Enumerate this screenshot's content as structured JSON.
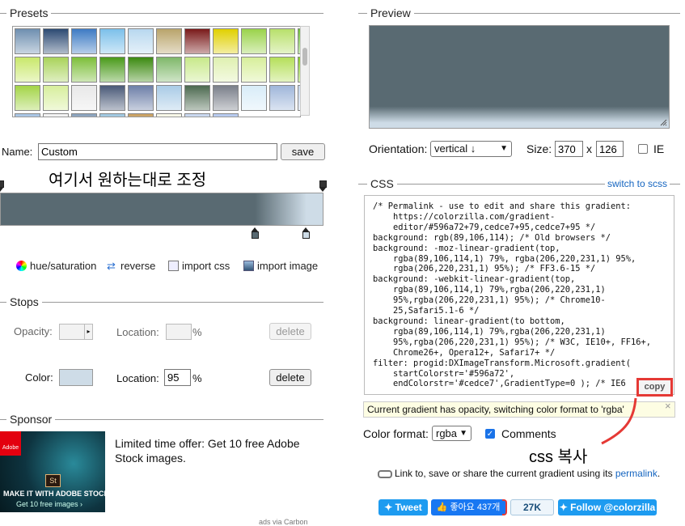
{
  "sections": {
    "presets": "Presets",
    "preview": "Preview",
    "css": "CSS",
    "stops": "Stops",
    "sponsor": "Sponsor"
  },
  "presets": {
    "swatches": [
      "#6f8fb0",
      "#2c4a73",
      "#3e7bc4",
      "#7cc0ea",
      "#b8d8ef",
      "#b9a46b",
      "#7a1a1a",
      "#e0d000",
      "#9ad34a",
      "#b8e06b",
      "#6fbf3a",
      "#6aa04a",
      "#c9e86b",
      "#a9d35a",
      "#7dbf3a",
      "#4a9a1a",
      "#3c8a10",
      "#7fb86a",
      "#c8e98a",
      "#dff0b0",
      "#d7ef9a",
      "#b5df5a",
      "#8acb2a",
      "#b4de4e",
      "#a3d447",
      "#d7ee9c",
      "#e8e8e8",
      "#4a5a78",
      "#6d7fa8",
      "#a9cbe6",
      "#4d6a50",
      "#7a7f8a",
      "#d8ecf8",
      "#9fb6da",
      "#c7d7ee",
      "#b9d1ea",
      "#a7c4e4",
      "#f2f2f2",
      "#8aa2bd",
      "#9fc7e0",
      "#c9a060",
      "#f7f7e7",
      "#c8d7ef",
      "#b5c9ef"
    ]
  },
  "name": {
    "label": "Name:",
    "value": "Custom",
    "save": "save"
  },
  "annotations": {
    "adjust": "여기서 원하는대로 조정",
    "css_copy": "css 복사"
  },
  "tools": {
    "hue": "hue/saturation",
    "reverse": "reverse",
    "import_css": "import css",
    "import_image": "import image"
  },
  "stops": {
    "opacity_label": "Opacity:",
    "location_label": "Location:",
    "percent": "%",
    "delete": "delete",
    "color_label": "Color:",
    "color_value": "#cedce7",
    "location_value": "95"
  },
  "sponsor": {
    "text": "Limited time offer: Get 10 free Adobe Stock images.",
    "ad_caption": "MAKE IT WITH ADOBE STOCK.",
    "ad_sub": "Get 10 free images ›",
    "ad_brand": "Adobe",
    "ad_logo": "St",
    "footer": "ads via Carbon"
  },
  "preview": {
    "orientation_label": "Orientation:",
    "orientation_value": "vertical ↓",
    "size_label": "Size:",
    "width": "370",
    "x": "x",
    "height": "126",
    "ie_label": "IE"
  },
  "css": {
    "switch_scss": "switch to scss",
    "code": "/* Permalink - use to edit and share this gradient:\n    https://colorzilla.com/gradient-\n    editor/#596a72+79,cedce7+95,cedce7+95 */\nbackground: rgb(89,106,114); /* Old browsers */\nbackground: -moz-linear-gradient(top,\n    rgba(89,106,114,1) 79%, rgba(206,220,231,1) 95%,\n    rgba(206,220,231,1) 95%); /* FF3.6-15 */\nbackground: -webkit-linear-gradient(top,\n    rgba(89,106,114,1) 79%,rgba(206,220,231,1)\n    95%,rgba(206,220,231,1) 95%); /* Chrome10-\n    25,Safari5.1-6 */\nbackground: linear-gradient(to bottom,\n    rgba(89,106,114,1) 79%,rgba(206,220,231,1)\n    95%,rgba(206,220,231,1) 95%); /* W3C, IE10+, FF16+,\n    Chrome26+, Opera12+, Safari7+ */\nfilter: progid:DXImageTransform.Microsoft.gradient(\n    startColorstr='#596a72',\n    endColorstr='#cedce7',GradientType=0 ); /* IE6",
    "copy": "copy",
    "notice": "Current gradient has opacity, switching color format to 'rgba'",
    "close": "×",
    "color_format_label": "Color format:",
    "color_format_value": "rgba",
    "comments_label": "Comments",
    "link_text": "Link to, save or share the current gradient using its",
    "permalink": "permalink",
    "period": "."
  },
  "social": {
    "tweet": "Tweet",
    "like": "좋아요 437개",
    "count": "27K",
    "follow": "Follow @colorzilla"
  },
  "colors": {
    "gradient_start": "#596a72",
    "gradient_end": "#cedce7",
    "annotation_red": "#e53935",
    "twitter_blue": "#1d9bf0",
    "facebook_blue": "#1877f2"
  }
}
